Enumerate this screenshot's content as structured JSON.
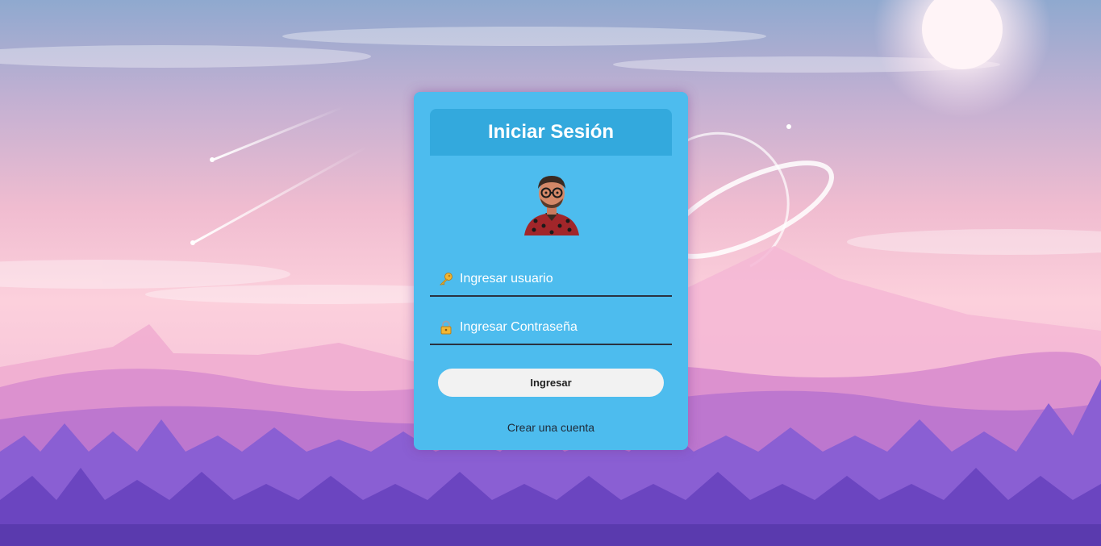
{
  "login": {
    "title": "Iniciar Sesión",
    "username_placeholder": "Ingresar usuario",
    "password_placeholder": "Ingresar Contraseña",
    "submit_label": "Ingresar",
    "register_link": "Crear una cuenta"
  },
  "icons": {
    "username": "key-icon",
    "password": "lock-icon"
  },
  "colors": {
    "card_background": "#4dbcee",
    "header_background": "#33a9dd",
    "button_background": "#f2f2f2"
  }
}
